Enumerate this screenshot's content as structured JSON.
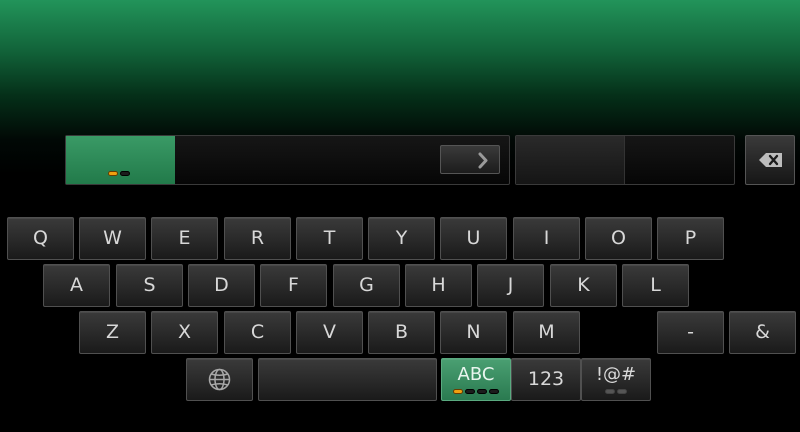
{
  "keyboard": {
    "row1": [
      "Q",
      "W",
      "E",
      "R",
      "T",
      "Y",
      "U",
      "I",
      "O",
      "P"
    ],
    "row2": [
      "A",
      "S",
      "D",
      "F",
      "G",
      "H",
      "J",
      "K",
      "L"
    ],
    "row3": [
      "Z",
      "X",
      "C",
      "V",
      "B",
      "N",
      "M"
    ],
    "punct": [
      "-",
      "&"
    ],
    "modes": {
      "abc": "ABC",
      "num": "123",
      "sym": "!@#"
    }
  }
}
